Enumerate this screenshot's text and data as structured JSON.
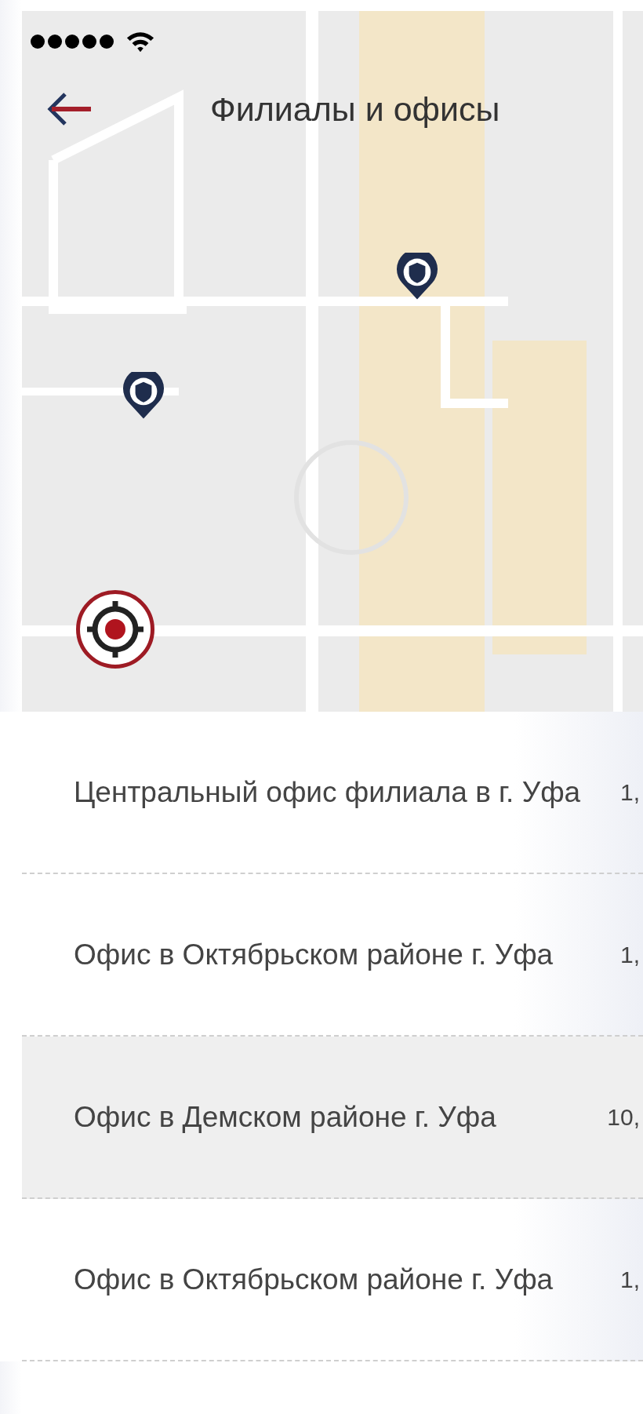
{
  "header": {
    "title": "Филиалы и офисы"
  },
  "offices": [
    {
      "name": "Центральный офис филиала в г. Уфа",
      "distance": "1,",
      "selected": false
    },
    {
      "name": "Офис в Октябрьском районе г. Уфа",
      "distance": "1,",
      "selected": false
    },
    {
      "name": "Офис в Демском районе г. Уфа",
      "distance": "10,",
      "selected": true
    },
    {
      "name": "Офис в Октябрьском районе г. Уфа",
      "distance": "1,",
      "selected": false
    }
  ]
}
